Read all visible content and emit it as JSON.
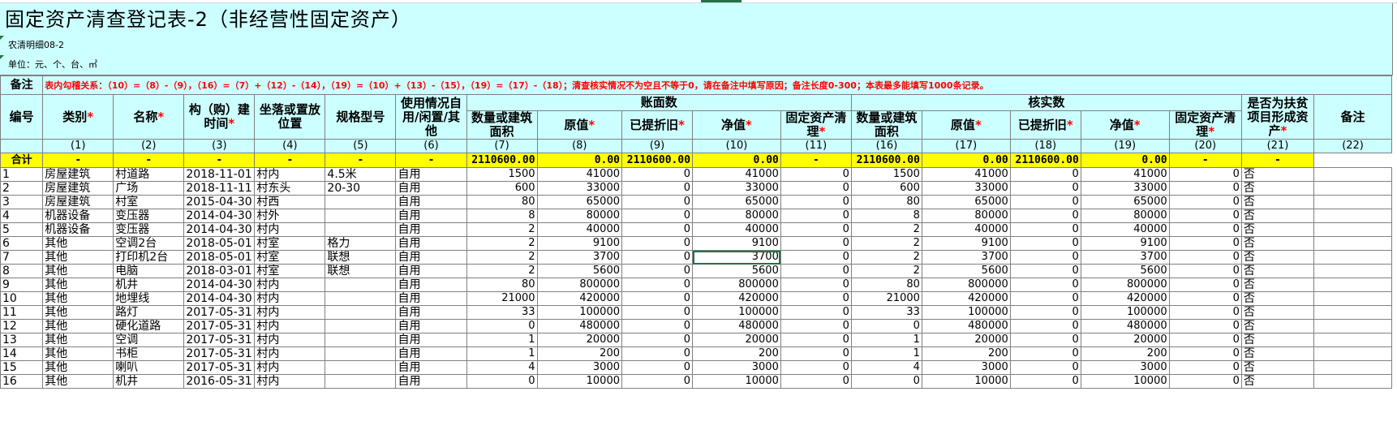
{
  "title": "固定资产清查登记表-2（非经营性固定资产）",
  "subtitle1": "农清明细08-2",
  "subtitle2": "单位：元、个、台、㎡",
  "note_label": "备注",
  "note_text": "表内勾稽关系：（10）=（8）-（9），（16）=（7）+（12）-（14），（19）=（10）+（13）-（15），（19）=（17）-（18）；清查核实情况不为空且不等于0，请在备注中填写原因；备注长度0-300；本表最多能填写1000条记录。",
  "headers": {
    "id": "编号",
    "category": "类别",
    "name": "名称",
    "build_time": "构（购）建时间",
    "location": "坐落或置放位置",
    "spec": "规格型号",
    "usage": "使用情况自用/闲置/其他",
    "book": "账面数",
    "verified": "核实数",
    "qty_book": "数量或建筑面积",
    "orig_book": "原值",
    "dep_book": "已提折旧",
    "net_book": "净值",
    "clean_book": "固定资产清理",
    "qty_ver": "数量或建筑面积",
    "orig_ver": "原值",
    "dep_ver": "已提折旧",
    "net_ver": "净值",
    "clean_ver": "固定资产清理",
    "poverty": "是否为扶贫项目形成资产",
    "remark": "备注",
    "star": "*"
  },
  "col_numbers": [
    "(1)",
    "(2)",
    "(3)",
    "(4)",
    "(5)",
    "(6)",
    "(7)",
    "(8)",
    "(9)",
    "(10)",
    "(11)",
    "(16)",
    "(17)",
    "(18)",
    "(19)",
    "(20)",
    "(21)",
    "(22)"
  ],
  "total": {
    "label": "合计",
    "cells": [
      "-",
      "-",
      "-",
      "-",
      "-",
      "-",
      "2110600.00",
      "0.00",
      "2110600.00",
      "0.00",
      "-",
      "2110600.00",
      "0.00",
      "2110600.00",
      "0.00",
      "-",
      "-"
    ]
  },
  "rows": [
    [
      "1",
      "房屋建筑",
      "村道路",
      "2018-11-01",
      "村内",
      "4.5米",
      "自用",
      "1500",
      "41000",
      "0",
      "41000",
      "0",
      "1500",
      "41000",
      "0",
      "41000",
      "0",
      "否"
    ],
    [
      "2",
      "房屋建筑",
      "广场",
      "2018-11-11",
      "村东头",
      "20-30",
      "自用",
      "600",
      "33000",
      "0",
      "33000",
      "0",
      "600",
      "33000",
      "0",
      "33000",
      "0",
      "否"
    ],
    [
      "3",
      "房屋建筑",
      "村室",
      "2015-04-30",
      "村西",
      "",
      "自用",
      "80",
      "65000",
      "0",
      "65000",
      "0",
      "80",
      "65000",
      "0",
      "65000",
      "0",
      "否"
    ],
    [
      "4",
      "机器设备",
      "变压器",
      "2014-04-30",
      "村外",
      "",
      "自用",
      "8",
      "80000",
      "0",
      "80000",
      "0",
      "8",
      "80000",
      "0",
      "80000",
      "0",
      "否"
    ],
    [
      "5",
      "机器设备",
      "变压器",
      "2014-04-30",
      "村内",
      "",
      "自用",
      "2",
      "40000",
      "0",
      "40000",
      "0",
      "2",
      "40000",
      "0",
      "40000",
      "0",
      "否"
    ],
    [
      "6",
      "其他",
      "空调2台",
      "2018-05-01",
      "村室",
      "格力",
      "自用",
      "2",
      "9100",
      "0",
      "9100",
      "0",
      "2",
      "9100",
      "0",
      "9100",
      "0",
      "否"
    ],
    [
      "7",
      "其他",
      "打印机2台",
      "2018-05-01",
      "村室",
      "联想",
      "自用",
      "2",
      "3700",
      "0",
      "3700",
      "0",
      "2",
      "3700",
      "0",
      "3700",
      "0",
      "否"
    ],
    [
      "8",
      "其他",
      "电脑",
      "2018-03-01",
      "村室",
      "联想",
      "自用",
      "2",
      "5600",
      "0",
      "5600",
      "0",
      "2",
      "5600",
      "0",
      "5600",
      "0",
      "否"
    ],
    [
      "9",
      "其他",
      "机井",
      "2014-04-30",
      "村内",
      "",
      "自用",
      "80",
      "800000",
      "0",
      "800000",
      "0",
      "80",
      "800000",
      "0",
      "800000",
      "0",
      "否"
    ],
    [
      "10",
      "其他",
      "地埋线",
      "2014-04-30",
      "村内",
      "",
      "自用",
      "21000",
      "420000",
      "0",
      "420000",
      "0",
      "21000",
      "420000",
      "0",
      "420000",
      "0",
      "否"
    ],
    [
      "11",
      "其他",
      "路灯",
      "2017-05-31",
      "村内",
      "",
      "自用",
      "33",
      "100000",
      "0",
      "100000",
      "0",
      "33",
      "100000",
      "0",
      "100000",
      "0",
      "否"
    ],
    [
      "12",
      "其他",
      "硬化道路",
      "2017-05-31",
      "村内",
      "",
      "自用",
      "0",
      "480000",
      "0",
      "480000",
      "0",
      "0",
      "480000",
      "0",
      "480000",
      "0",
      "否"
    ],
    [
      "13",
      "其他",
      "空调",
      "2017-05-31",
      "村内",
      "",
      "自用",
      "1",
      "20000",
      "0",
      "20000",
      "0",
      "1",
      "20000",
      "0",
      "20000",
      "0",
      "否"
    ],
    [
      "14",
      "其他",
      "书柜",
      "2017-05-31",
      "村内",
      "",
      "自用",
      "1",
      "200",
      "0",
      "200",
      "0",
      "1",
      "200",
      "0",
      "200",
      "0",
      "否"
    ],
    [
      "15",
      "其他",
      "喇叭",
      "2017-05-31",
      "村内",
      "",
      "自用",
      "4",
      "3000",
      "0",
      "3000",
      "0",
      "4",
      "3000",
      "0",
      "3000",
      "0",
      "否"
    ],
    [
      "16",
      "其他",
      "机井",
      "2016-05-31",
      "村内",
      "",
      "自用",
      "0",
      "10000",
      "0",
      "10000",
      "0",
      "0",
      "10000",
      "0",
      "10000",
      "0",
      "否"
    ]
  ],
  "colors": {
    "header_bg": "#ccffff",
    "total_bg": "#ffff00",
    "note_text": "#ff0000",
    "selection": "#217346"
  }
}
